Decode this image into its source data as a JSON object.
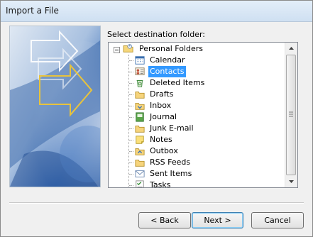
{
  "window": {
    "title": "Import a File"
  },
  "prompt": "Select destination folder:",
  "tree": {
    "root": {
      "label": "Personal Folders",
      "icon": "personal-folders-icon",
      "expanded": true
    },
    "items": [
      {
        "label": "Calendar",
        "icon": "calendar-icon",
        "selected": false
      },
      {
        "label": "Contacts",
        "icon": "contacts-icon",
        "selected": true
      },
      {
        "label": "Deleted Items",
        "icon": "deleted-items-icon",
        "selected": false
      },
      {
        "label": "Drafts",
        "icon": "folder-icon",
        "selected": false
      },
      {
        "label": "Inbox",
        "icon": "inbox-icon",
        "selected": false
      },
      {
        "label": "Journal",
        "icon": "journal-icon",
        "selected": false
      },
      {
        "label": "Junk E-mail",
        "icon": "folder-icon",
        "selected": false
      },
      {
        "label": "Notes",
        "icon": "notes-icon",
        "selected": false
      },
      {
        "label": "Outbox",
        "icon": "outbox-icon",
        "selected": false
      },
      {
        "label": "RSS Feeds",
        "icon": "folder-icon",
        "selected": false
      },
      {
        "label": "Sent Items",
        "icon": "sent-items-icon",
        "selected": false
      },
      {
        "label": "Tasks",
        "icon": "tasks-icon",
        "selected": false
      }
    ]
  },
  "buttons": {
    "back": "< Back",
    "next": "Next >",
    "cancel": "Cancel"
  },
  "colors": {
    "selection": "#3399ff",
    "banner_blue": "#2f5fa8"
  }
}
